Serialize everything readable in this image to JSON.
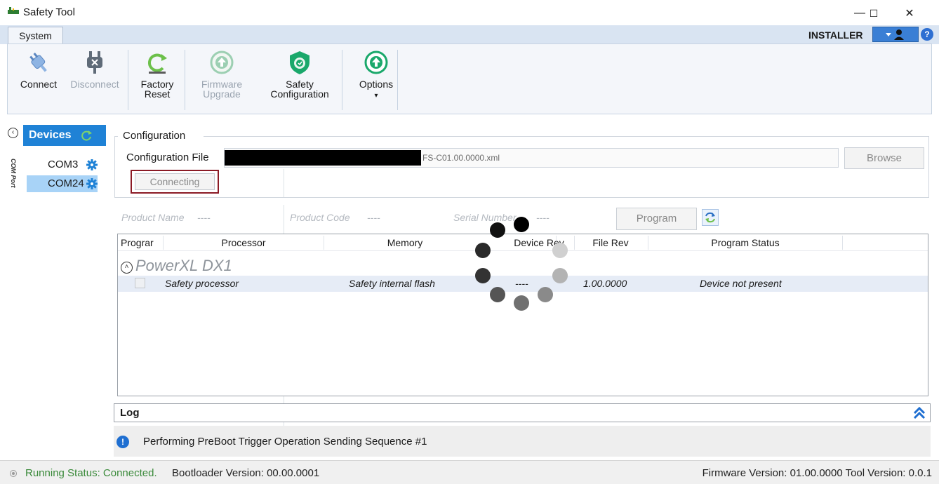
{
  "window": {
    "title": "Safety Tool",
    "minimize": "—",
    "maximize": "☐",
    "close": "✕"
  },
  "ribbon": {
    "tab": "System",
    "user_role": "INSTALLER",
    "help": "?",
    "buttons": {
      "connect": "Connect",
      "disconnect": "Disconnect",
      "factory_reset_1": "Factory",
      "factory_reset_2": "Reset",
      "firmware_upgrade_1": "Firmware",
      "firmware_upgrade_2": "Upgrade",
      "safety_config_1": "Safety",
      "safety_config_2": "Configuration",
      "options": "Options",
      "options_arrow": "▾"
    }
  },
  "sidebar": {
    "collapse": "‹",
    "devices_label": "Devices",
    "port_header": "COM Port",
    "ports": [
      {
        "label": "COM3",
        "selected": false
      },
      {
        "label": "COM24",
        "selected": true
      }
    ]
  },
  "configuration": {
    "legend": "Configuration",
    "file_label": "Configuration File",
    "file_name": "FS-C01.00.0000.xml",
    "browse": "Browse",
    "connecting": "Connecting"
  },
  "product": {
    "name_label": "Product Name",
    "name_value": "----",
    "code_label": "Product Code",
    "code_value": "----",
    "serial_label": "Serial Number",
    "serial_value": "----",
    "program": "Program"
  },
  "grid": {
    "columns": [
      "Prograr",
      "Processor",
      "Memory",
      "Device Rev",
      "File Rev",
      "Program Status"
    ],
    "group": "PowerXL DX1",
    "group_toggle": "˄",
    "rows": [
      {
        "processor": "Safety processor",
        "memory": "Safety internal flash",
        "device_rev": "----",
        "file_rev": "1.00.0000",
        "status": "Device not present"
      }
    ]
  },
  "log": {
    "title": "Log",
    "info_icon": "!",
    "message": "Performing PreBoot Trigger Operation Sending Sequence #1"
  },
  "status": {
    "running": "Running Status: Connected.",
    "bootloader": "Bootloader Version: 00.00.0001",
    "versions": "Firmware Version: 01.00.0000 Tool Version: 0.0.1"
  },
  "colors": {
    "accent": "#1f82d6",
    "selected_port": "#a8d3f7",
    "connected_green": "#3a8a3a",
    "highlight_outline": "#8b1a25",
    "ribbon_tab_bg": "#d9e4f2"
  }
}
